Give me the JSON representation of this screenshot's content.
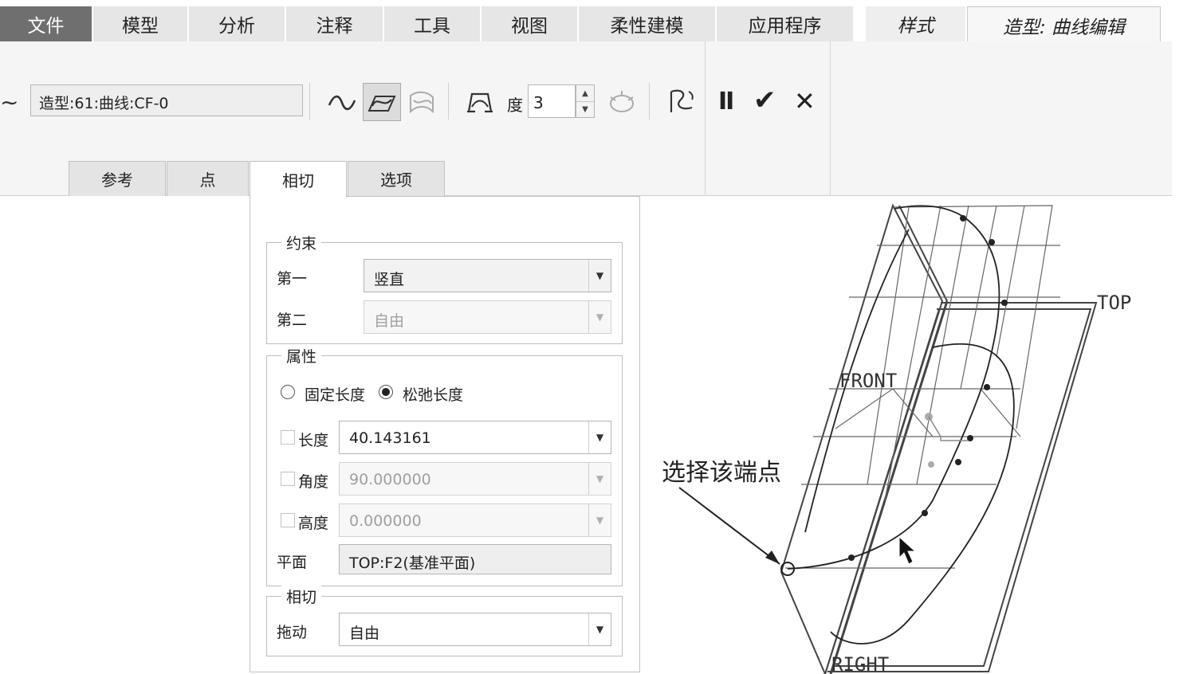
{
  "ribbon": {
    "tabs": [
      "文件",
      "模型",
      "分析",
      "注释",
      "工具",
      "视图",
      "柔性建模",
      "应用程序",
      "样式",
      "造型: 曲线编辑"
    ]
  },
  "toolbar": {
    "curve_name": "造型:61:曲线:CF-0",
    "degree_label": "度",
    "degree_value": "3",
    "pause_label": "II",
    "ok_label": "✔",
    "cancel_label": "✕"
  },
  "dashboard_tabs": [
    "参考",
    "点",
    "相切",
    "选项"
  ],
  "panel": {
    "constraint": {
      "title": "约束",
      "first_label": "第一",
      "first_value": "竖直",
      "second_label": "第二",
      "second_value": "自由"
    },
    "properties": {
      "title": "属性",
      "fixed_length": "固定长度",
      "relaxed_length": "松弛长度",
      "length_label": "长度",
      "length_value": "40.143161",
      "angle_label": "角度",
      "angle_value": "90.000000",
      "height_label": "高度",
      "height_value": "0.000000",
      "plane_label": "平面",
      "plane_value": "TOP:F2(基准平面)"
    },
    "tangent": {
      "title": "相切",
      "drag_label": "拖动",
      "drag_value": "自由"
    }
  },
  "graphics": {
    "plane_top": "TOP",
    "plane_front": "FRONT",
    "plane_right": "RIGHT",
    "callout": "选择该端点"
  }
}
